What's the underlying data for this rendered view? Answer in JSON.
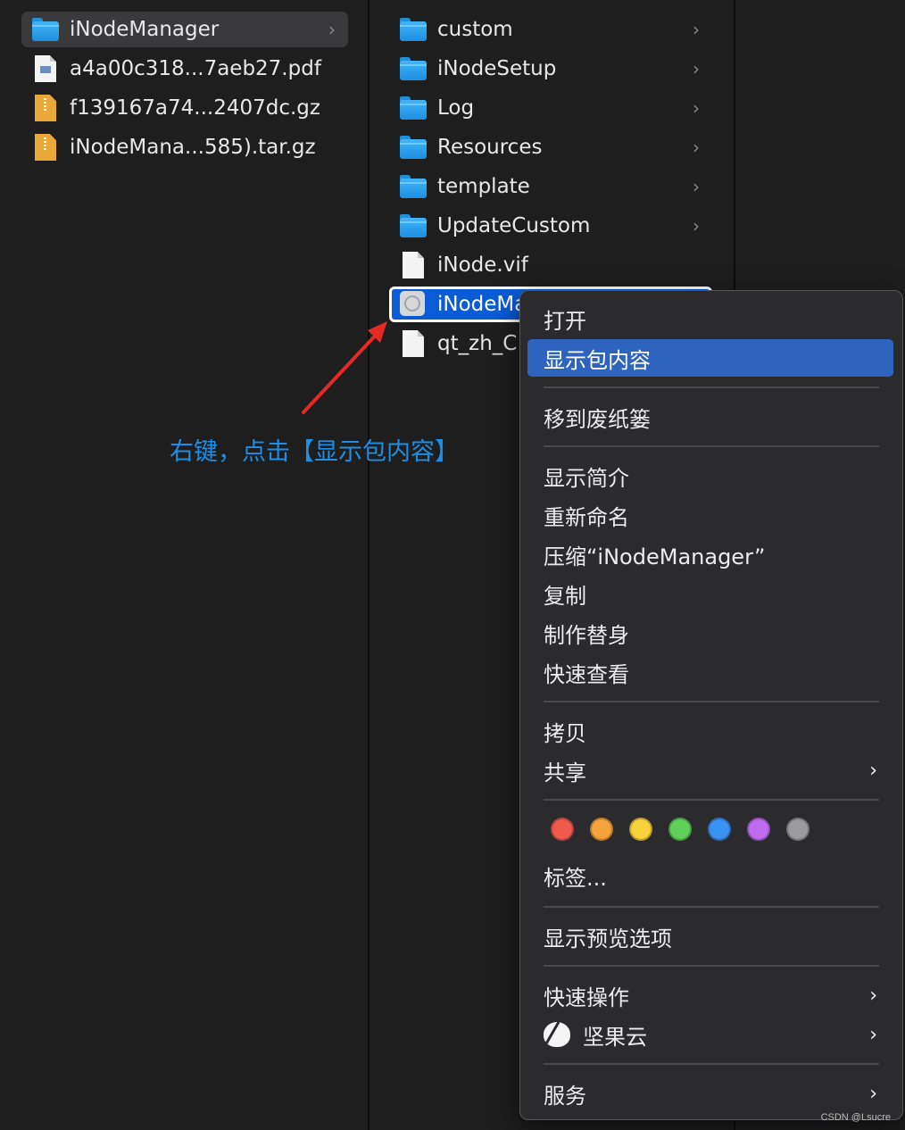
{
  "column1": {
    "items": [
      {
        "name": "iNodeManager",
        "icon": "folder-icon",
        "selected": true,
        "chevron": "›"
      },
      {
        "name": "a4a00c318...7aeb27.pdf",
        "icon": "pdf-file-icon"
      },
      {
        "name": "f139167a74...2407dc.gz",
        "icon": "archive-file-icon"
      },
      {
        "name": "iNodeMana...585).tar.gz",
        "icon": "archive-file-icon"
      }
    ]
  },
  "column2": {
    "items": [
      {
        "name": "custom",
        "icon": "folder-icon",
        "chevron": "›"
      },
      {
        "name": "iNodeSetup",
        "icon": "folder-icon",
        "chevron": "›"
      },
      {
        "name": "Log",
        "icon": "folder-icon",
        "chevron": "›"
      },
      {
        "name": "Resources",
        "icon": "folder-icon",
        "chevron": "›"
      },
      {
        "name": "template",
        "icon": "folder-icon",
        "chevron": "›"
      },
      {
        "name": "UpdateCustom",
        "icon": "folder-icon",
        "chevron": "›"
      },
      {
        "name": "iNode.vif",
        "icon": "document-icon"
      },
      {
        "name": "iNodeMa",
        "icon": "app-icon",
        "focused": true
      },
      {
        "name": "qt_zh_C",
        "icon": "document-icon"
      }
    ]
  },
  "annotation": {
    "text": "右键，点击【显示包内容】",
    "color": "#1d8ee6"
  },
  "context_menu": {
    "items": {
      "open": "打开",
      "show_package_contents": "显示包内容",
      "move_to_trash": "移到废纸篓",
      "get_info": "显示简介",
      "rename": "重新命名",
      "compress": "压缩“iNodeManager”",
      "duplicate": "复制",
      "make_alias": "制作替身",
      "quick_look": "快速查看",
      "copy": "拷贝",
      "share": "共享",
      "tags": "标签...",
      "show_view_options": "显示预览选项",
      "quick_actions": "快速操作",
      "jianguoyun": "坚果云",
      "services": "服务"
    },
    "submenu_arrow": "›",
    "tag_colors": [
      "#ef5a4f",
      "#f5a33a",
      "#f7d23c",
      "#5fd15a",
      "#3a92f5",
      "#bf6cf0",
      "#9b9b9d"
    ],
    "highlight_color": "#2f64be"
  },
  "watermark": "CSDN @Lsucre"
}
